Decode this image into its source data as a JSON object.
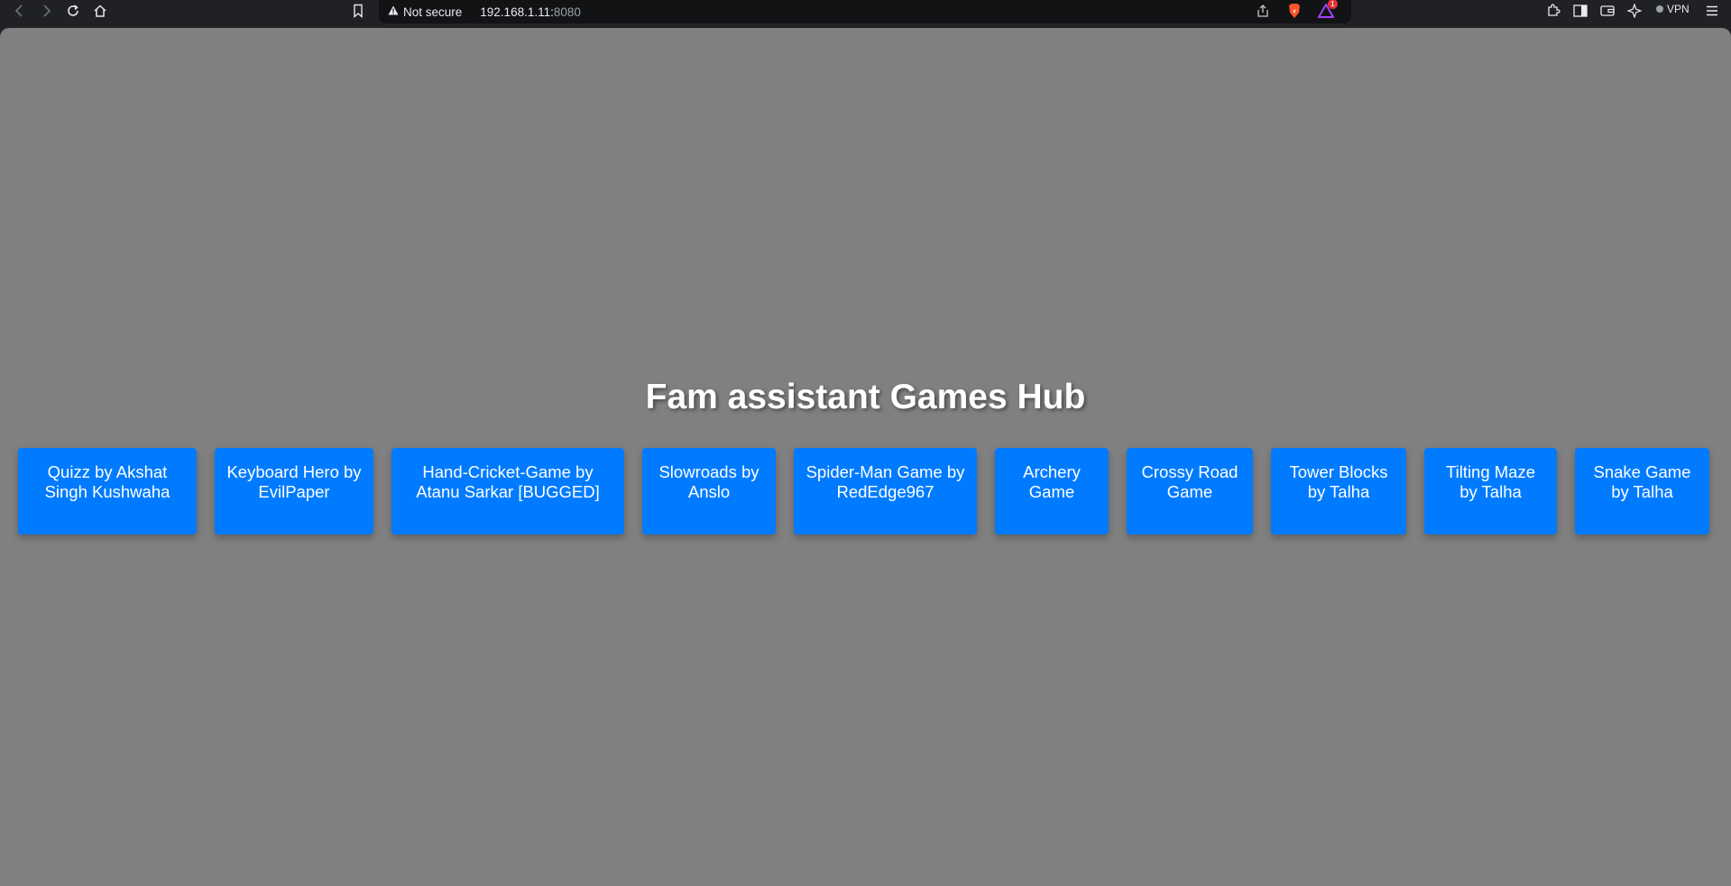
{
  "browser": {
    "back_icon": "chevron-left-icon",
    "forward_icon": "chevron-right-icon",
    "reload_icon": "reload-icon",
    "home_icon": "home-icon",
    "bookmark_icon": "bookmark-icon",
    "security_label": "Not secure",
    "url_host": "192.168.1.11:",
    "url_port": "8080",
    "rewards_badge": "1",
    "vpn_label": "VPN"
  },
  "page": {
    "background": "#808080",
    "title": "Fam assistant Games Hub",
    "button_color": "#007bff",
    "games": [
      {
        "label": "Quizz by Akshat Singh Kushwaha"
      },
      {
        "label": "Keyboard Hero by EvilPaper"
      },
      {
        "label": "Hand-Cricket-Game by Atanu Sarkar [BUGGED]"
      },
      {
        "label": "Slowroads by Anslo"
      },
      {
        "label": "Spider-Man Game by RedEdge967"
      },
      {
        "label": "Archery Game"
      },
      {
        "label": "Crossy Road Game"
      },
      {
        "label": "Tower Blocks by Talha"
      },
      {
        "label": "Tilting Maze by Talha"
      },
      {
        "label": "Snake Game by Talha"
      }
    ]
  }
}
